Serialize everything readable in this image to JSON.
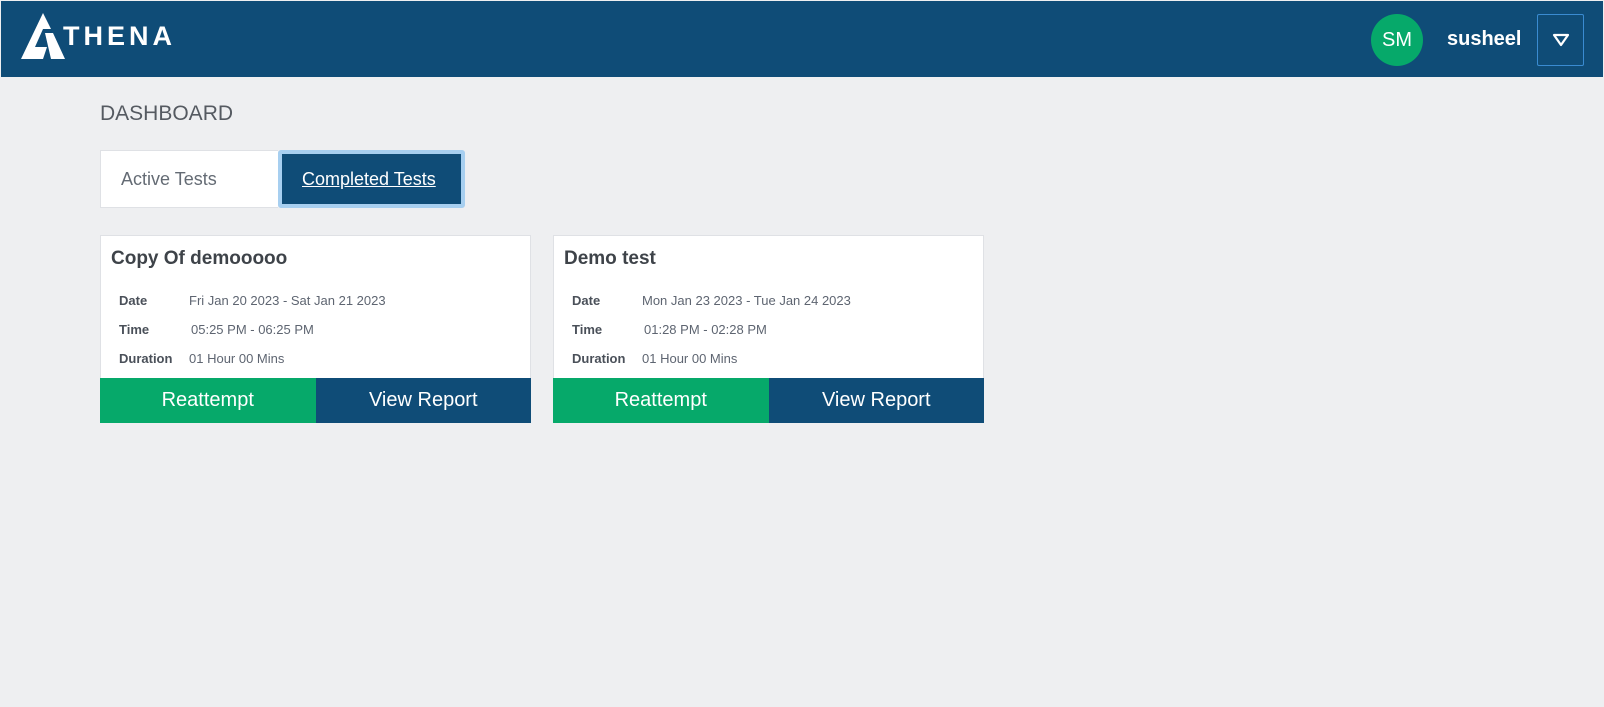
{
  "header": {
    "logo_text": "THENA",
    "logo_letter": "A",
    "avatar_initials": "SM",
    "username": "susheel",
    "dropdown_icon": "triangle-down-icon"
  },
  "page": {
    "title": "DASHBOARD"
  },
  "tabs": [
    {
      "label": "Active Tests",
      "selected": false
    },
    {
      "label": "Completed Tests",
      "selected": true
    }
  ],
  "labels": {
    "date": "Date",
    "time": "Time",
    "duration": "Duration",
    "reattempt": "Reattempt",
    "view_report": "View Report"
  },
  "tests": [
    {
      "title": "Copy Of demooooo",
      "date": "Fri Jan 20 2023 - Sat Jan 21 2023",
      "time": "05:25 PM - 06:25 PM",
      "duration": "01 Hour 00 Mins"
    },
    {
      "title": "Demo test",
      "date": "Mon Jan 23 2023 - Tue Jan 24 2023",
      "time": "01:28 PM - 02:28 PM",
      "duration": "01 Hour 00 Mins"
    }
  ],
  "colors": {
    "header_bg": "#0f4c77",
    "accent_green": "#06a96a",
    "page_bg": "#eeeff1"
  }
}
